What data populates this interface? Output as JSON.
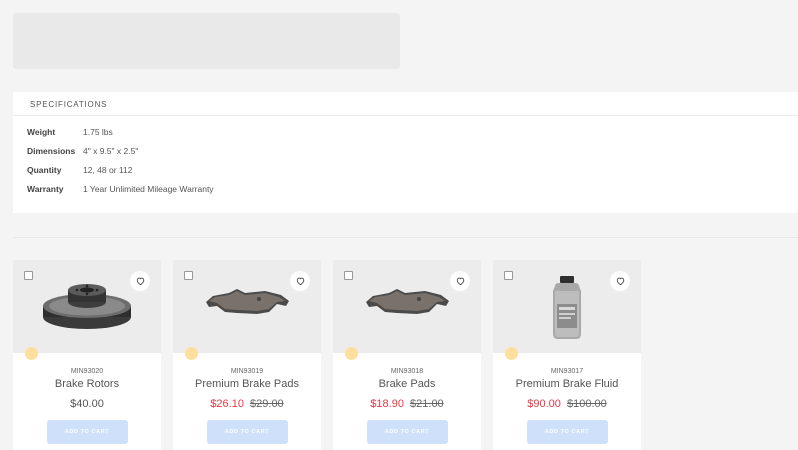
{
  "specifications": {
    "title": "SPECIFICATIONS",
    "rows": [
      {
        "label": "Weight",
        "value": "1.75 lbs"
      },
      {
        "label": "Dimensions",
        "value": "4\" x 9.5\" x 2.5\""
      },
      {
        "label": "Quantity",
        "value": "12, 48 or 112"
      },
      {
        "label": "Warranty",
        "value": "1 Year Unlimited Mileage Warranty"
      }
    ]
  },
  "products": [
    {
      "sku": "MIN93020",
      "name": "Brake Rotors",
      "price": "$40.00",
      "old_price": "",
      "image": "brake-rotor-icon"
    },
    {
      "sku": "MIN93019",
      "name": "Premium Brake Pads",
      "price": "$26.10",
      "old_price": "$29.00",
      "image": "brake-pad-icon"
    },
    {
      "sku": "MIN93018",
      "name": "Brake Pads",
      "price": "$18.90",
      "old_price": "$21.00",
      "image": "brake-pad-icon"
    },
    {
      "sku": "MIN93017",
      "name": "Premium Brake Fluid",
      "price": "$90.00",
      "old_price": "$100.00",
      "image": "brake-fluid-bottle-icon"
    }
  ],
  "cart_label": "ADD TO CART",
  "colors": {
    "sale": "#e63946",
    "button": "#cfe0fb",
    "badge": "#ffdf9e"
  }
}
